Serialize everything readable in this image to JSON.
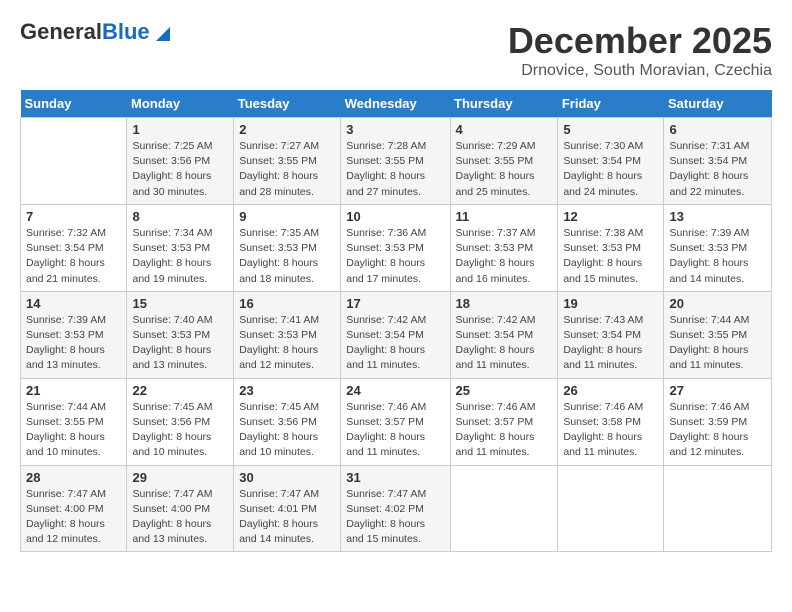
{
  "header": {
    "logo_general": "General",
    "logo_blue": "Blue",
    "month": "December 2025",
    "location": "Drnovice, South Moravian, Czechia"
  },
  "weekdays": [
    "Sunday",
    "Monday",
    "Tuesday",
    "Wednesday",
    "Thursday",
    "Friday",
    "Saturday"
  ],
  "weeks": [
    [
      {
        "day": "",
        "info": ""
      },
      {
        "day": "1",
        "info": "Sunrise: 7:25 AM\nSunset: 3:56 PM\nDaylight: 8 hours\nand 30 minutes."
      },
      {
        "day": "2",
        "info": "Sunrise: 7:27 AM\nSunset: 3:55 PM\nDaylight: 8 hours\nand 28 minutes."
      },
      {
        "day": "3",
        "info": "Sunrise: 7:28 AM\nSunset: 3:55 PM\nDaylight: 8 hours\nand 27 minutes."
      },
      {
        "day": "4",
        "info": "Sunrise: 7:29 AM\nSunset: 3:55 PM\nDaylight: 8 hours\nand 25 minutes."
      },
      {
        "day": "5",
        "info": "Sunrise: 7:30 AM\nSunset: 3:54 PM\nDaylight: 8 hours\nand 24 minutes."
      },
      {
        "day": "6",
        "info": "Sunrise: 7:31 AM\nSunset: 3:54 PM\nDaylight: 8 hours\nand 22 minutes."
      }
    ],
    [
      {
        "day": "7",
        "info": "Sunrise: 7:32 AM\nSunset: 3:54 PM\nDaylight: 8 hours\nand 21 minutes."
      },
      {
        "day": "8",
        "info": "Sunrise: 7:34 AM\nSunset: 3:53 PM\nDaylight: 8 hours\nand 19 minutes."
      },
      {
        "day": "9",
        "info": "Sunrise: 7:35 AM\nSunset: 3:53 PM\nDaylight: 8 hours\nand 18 minutes."
      },
      {
        "day": "10",
        "info": "Sunrise: 7:36 AM\nSunset: 3:53 PM\nDaylight: 8 hours\nand 17 minutes."
      },
      {
        "day": "11",
        "info": "Sunrise: 7:37 AM\nSunset: 3:53 PM\nDaylight: 8 hours\nand 16 minutes."
      },
      {
        "day": "12",
        "info": "Sunrise: 7:38 AM\nSunset: 3:53 PM\nDaylight: 8 hours\nand 15 minutes."
      },
      {
        "day": "13",
        "info": "Sunrise: 7:39 AM\nSunset: 3:53 PM\nDaylight: 8 hours\nand 14 minutes."
      }
    ],
    [
      {
        "day": "14",
        "info": "Sunrise: 7:39 AM\nSunset: 3:53 PM\nDaylight: 8 hours\nand 13 minutes."
      },
      {
        "day": "15",
        "info": "Sunrise: 7:40 AM\nSunset: 3:53 PM\nDaylight: 8 hours\nand 13 minutes."
      },
      {
        "day": "16",
        "info": "Sunrise: 7:41 AM\nSunset: 3:53 PM\nDaylight: 8 hours\nand 12 minutes."
      },
      {
        "day": "17",
        "info": "Sunrise: 7:42 AM\nSunset: 3:54 PM\nDaylight: 8 hours\nand 11 minutes."
      },
      {
        "day": "18",
        "info": "Sunrise: 7:42 AM\nSunset: 3:54 PM\nDaylight: 8 hours\nand 11 minutes."
      },
      {
        "day": "19",
        "info": "Sunrise: 7:43 AM\nSunset: 3:54 PM\nDaylight: 8 hours\nand 11 minutes."
      },
      {
        "day": "20",
        "info": "Sunrise: 7:44 AM\nSunset: 3:55 PM\nDaylight: 8 hours\nand 11 minutes."
      }
    ],
    [
      {
        "day": "21",
        "info": "Sunrise: 7:44 AM\nSunset: 3:55 PM\nDaylight: 8 hours\nand 10 minutes."
      },
      {
        "day": "22",
        "info": "Sunrise: 7:45 AM\nSunset: 3:56 PM\nDaylight: 8 hours\nand 10 minutes."
      },
      {
        "day": "23",
        "info": "Sunrise: 7:45 AM\nSunset: 3:56 PM\nDaylight: 8 hours\nand 10 minutes."
      },
      {
        "day": "24",
        "info": "Sunrise: 7:46 AM\nSunset: 3:57 PM\nDaylight: 8 hours\nand 11 minutes."
      },
      {
        "day": "25",
        "info": "Sunrise: 7:46 AM\nSunset: 3:57 PM\nDaylight: 8 hours\nand 11 minutes."
      },
      {
        "day": "26",
        "info": "Sunrise: 7:46 AM\nSunset: 3:58 PM\nDaylight: 8 hours\nand 11 minutes."
      },
      {
        "day": "27",
        "info": "Sunrise: 7:46 AM\nSunset: 3:59 PM\nDaylight: 8 hours\nand 12 minutes."
      }
    ],
    [
      {
        "day": "28",
        "info": "Sunrise: 7:47 AM\nSunset: 4:00 PM\nDaylight: 8 hours\nand 12 minutes."
      },
      {
        "day": "29",
        "info": "Sunrise: 7:47 AM\nSunset: 4:00 PM\nDaylight: 8 hours\nand 13 minutes."
      },
      {
        "day": "30",
        "info": "Sunrise: 7:47 AM\nSunset: 4:01 PM\nDaylight: 8 hours\nand 14 minutes."
      },
      {
        "day": "31",
        "info": "Sunrise: 7:47 AM\nSunset: 4:02 PM\nDaylight: 8 hours\nand 15 minutes."
      },
      {
        "day": "",
        "info": ""
      },
      {
        "day": "",
        "info": ""
      },
      {
        "day": "",
        "info": ""
      }
    ]
  ]
}
